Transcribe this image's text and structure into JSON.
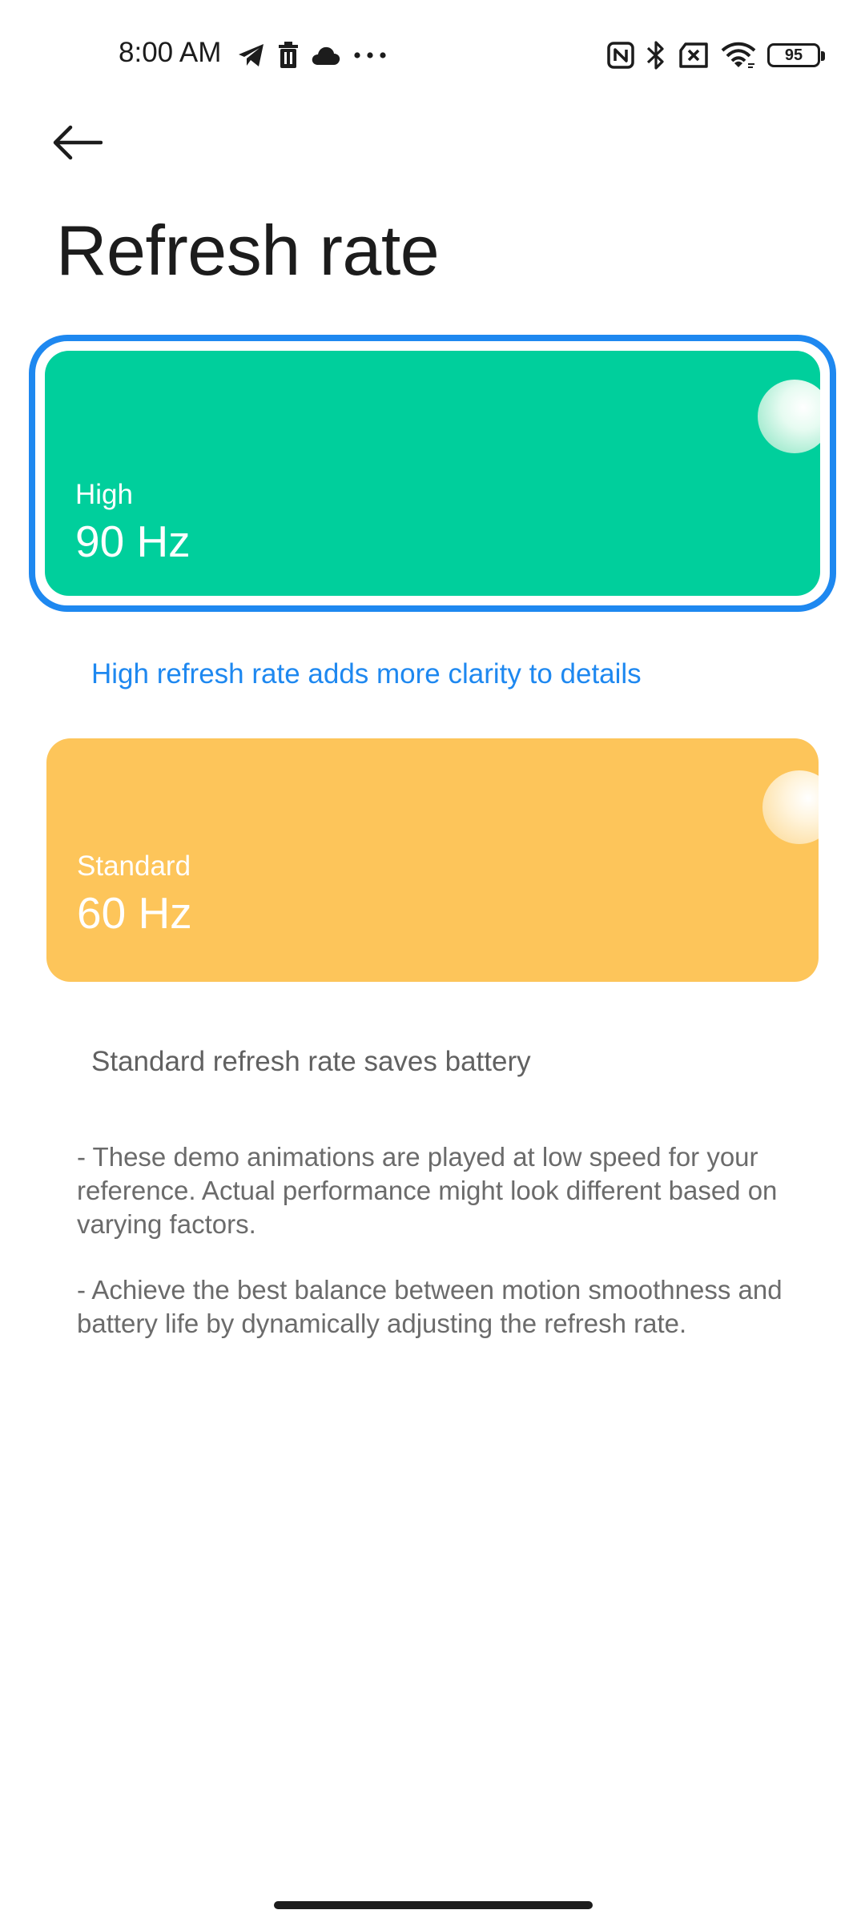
{
  "status_bar": {
    "time": "8:00 AM",
    "left_icons": [
      "telegram-icon",
      "trash-icon",
      "cloud-icon",
      "more-dots-icon"
    ],
    "right_icons": [
      "nfc-icon",
      "bluetooth-icon",
      "no-sim-icon",
      "wifi-icon",
      "battery-icon"
    ],
    "battery_level": "95"
  },
  "header": {
    "back_icon": "arrow-left-icon",
    "title": "Refresh rate"
  },
  "options": [
    {
      "label": "High",
      "value": "90 Hz",
      "description": "High refresh rate adds more clarity to details",
      "selected": true,
      "color": "#00cf9c"
    },
    {
      "label": "Standard",
      "value": "60 Hz",
      "description": "Standard refresh rate saves battery",
      "selected": false,
      "color": "#fdc55a"
    }
  ],
  "notes": [
    "- These demo animations are played at low speed for your reference. Actual performance might look different based on varying factors.",
    "- Achieve the best balance between motion smoothness and battery life by dynamically adjusting the refresh rate."
  ],
  "colors": {
    "accent": "#1e88f0",
    "text_primary": "#1c1c1c",
    "text_secondary": "#616161"
  }
}
